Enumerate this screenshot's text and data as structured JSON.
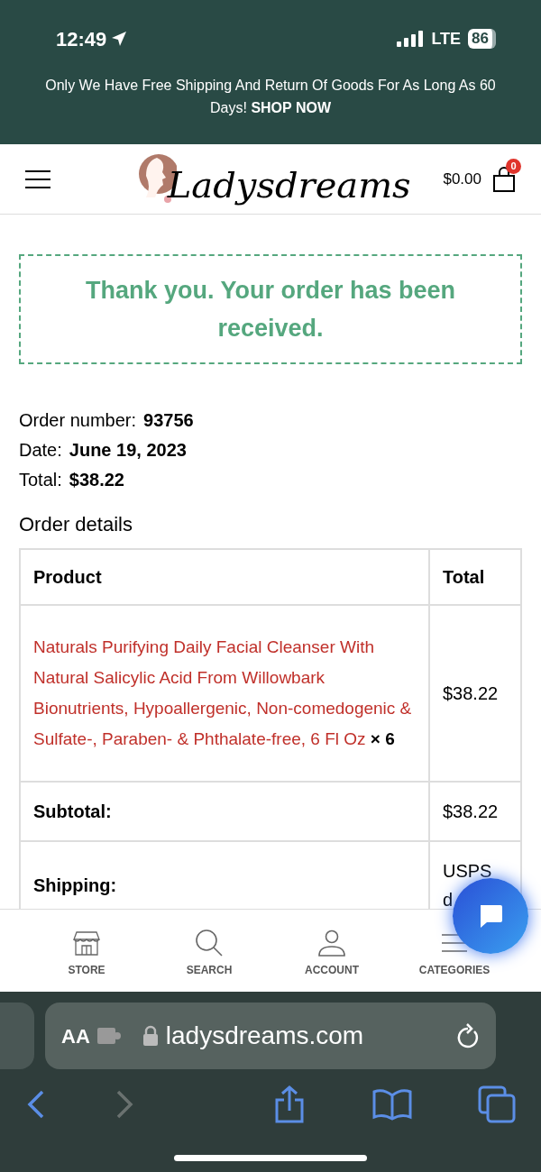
{
  "status_bar": {
    "time": "12:49",
    "network": "LTE",
    "battery": "86"
  },
  "banner": {
    "text": "Only We Have Free Shipping And Return Of Goods For As Long As 60 Days!",
    "link": "SHOP NOW"
  },
  "header": {
    "logo": "Ladysdreams",
    "cart_total": "$0.00",
    "cart_count": "0"
  },
  "notice": "Thank you. Your order has been received.",
  "order_info": [
    {
      "label": "Order number:",
      "value": "93756"
    },
    {
      "label": "Date:",
      "value": "June 19, 2023"
    },
    {
      "label": "Total:",
      "value": "$38.22"
    }
  ],
  "order_details": {
    "title": "Order details",
    "columns": [
      "Product",
      "Total"
    ],
    "rows": [
      {
        "kind": "item",
        "product": "Naturals Purifying Daily Facial Cleanser With Natural Salicylic Acid From Willowbark Bionutrients, Hypoallergenic, Non-comedogenic & Sulfate-, Paraben- & Phthalate-free, 6 Fl Oz",
        "quantity": "× 6",
        "total": "$38.22"
      },
      {
        "kind": "summary",
        "label": "Subtotal:",
        "value": "$38.22"
      },
      {
        "kind": "summary",
        "label": "Shipping:",
        "value": "USPS d"
      }
    ]
  },
  "bottom_nav": [
    {
      "label": "STORE"
    },
    {
      "label": "SEARCH"
    },
    {
      "label": "ACCOUNT"
    },
    {
      "label": "CATEGORIES"
    }
  ],
  "browser": {
    "text_size": "AA",
    "address": "ladysdreams.com"
  }
}
